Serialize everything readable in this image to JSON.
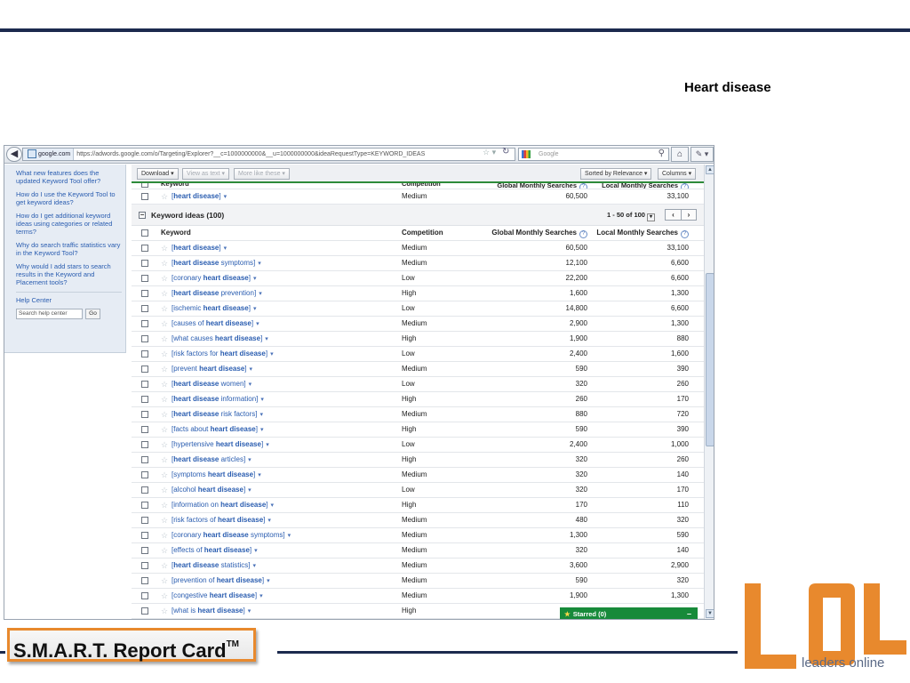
{
  "slide": {
    "title": "Heart disease"
  },
  "browser": {
    "site_label": "google.com",
    "url": "https://adwords.google.com/o/Targeting/Explorer?__c=1000000000&__u=1000000000&ideaRequestType=KEYWORD_IDEAS",
    "search_placeholder": "Google"
  },
  "help": {
    "links": [
      "What new features does the updated Keyword Tool offer?",
      "How do I use the Keyword Tool to get keyword ideas?",
      "How do I get additional keyword ideas using categories or related terms?",
      "Why do search traffic statistics vary in the Keyword Tool?",
      "Why would I add stars to search results in the Keyword and Placement tools?"
    ],
    "help_center": "Help Center",
    "search_placeholder": "Search help center",
    "go_label": "Go"
  },
  "toolbar": {
    "download": "Download ▾",
    "view_as_text": "View as text ▾",
    "more_like_these": "More like these ▾",
    "sorted_by": "Sorted by Relevance ▾",
    "columns": "Columns ▾"
  },
  "columns": {
    "keyword": "Keyword",
    "competition": "Competition",
    "global": "Global Monthly Searches",
    "local": "Local Monthly Searches"
  },
  "search_terms": [
    {
      "pre": "[",
      "bold": "heart disease",
      "post": "]",
      "competition": "Medium",
      "global": "60,500",
      "local": "33,100"
    }
  ],
  "ideas_group": {
    "title": "Keyword ideas (100)",
    "range": "1 - 50",
    "of_label": "of",
    "total": "100"
  },
  "keyword_ideas": [
    {
      "pre": "[",
      "bold": "heart disease",
      "post": "]",
      "competition": "Medium",
      "global": "60,500",
      "local": "33,100"
    },
    {
      "pre": "[",
      "bold": "heart disease",
      "post": " symptoms]",
      "competition": "Medium",
      "global": "12,100",
      "local": "6,600"
    },
    {
      "pre": "[coronary ",
      "bold": "heart disease",
      "post": "]",
      "competition": "Low",
      "global": "22,200",
      "local": "6,600"
    },
    {
      "pre": "[",
      "bold": "heart disease",
      "post": " prevention]",
      "competition": "High",
      "global": "1,600",
      "local": "1,300"
    },
    {
      "pre": "[ischemic ",
      "bold": "heart disease",
      "post": "]",
      "competition": "Low",
      "global": "14,800",
      "local": "6,600"
    },
    {
      "pre": "[causes of ",
      "bold": "heart disease",
      "post": "]",
      "competition": "Medium",
      "global": "2,900",
      "local": "1,300"
    },
    {
      "pre": "[what causes ",
      "bold": "heart disease",
      "post": "]",
      "competition": "High",
      "global": "1,900",
      "local": "880"
    },
    {
      "pre": "[risk factors for ",
      "bold": "heart disease",
      "post": "]",
      "competition": "Low",
      "global": "2,400",
      "local": "1,600"
    },
    {
      "pre": "[prevent ",
      "bold": "heart disease",
      "post": "]",
      "competition": "Medium",
      "global": "590",
      "local": "390"
    },
    {
      "pre": "[",
      "bold": "heart disease",
      "post": " women]",
      "competition": "Low",
      "global": "320",
      "local": "260"
    },
    {
      "pre": "[",
      "bold": "heart disease",
      "post": " information]",
      "competition": "High",
      "global": "260",
      "local": "170"
    },
    {
      "pre": "[",
      "bold": "heart disease",
      "post": " risk factors]",
      "competition": "Medium",
      "global": "880",
      "local": "720"
    },
    {
      "pre": "[facts about ",
      "bold": "heart disease",
      "post": "]",
      "competition": "High",
      "global": "590",
      "local": "390"
    },
    {
      "pre": "[hypertensive ",
      "bold": "heart disease",
      "post": "]",
      "competition": "Low",
      "global": "2,400",
      "local": "1,000"
    },
    {
      "pre": "[",
      "bold": "heart disease",
      "post": " articles]",
      "competition": "High",
      "global": "320",
      "local": "260"
    },
    {
      "pre": "[symptoms ",
      "bold": "heart disease",
      "post": "]",
      "competition": "Medium",
      "global": "320",
      "local": "140"
    },
    {
      "pre": "[alcohol ",
      "bold": "heart disease",
      "post": "]",
      "competition": "Low",
      "global": "320",
      "local": "170"
    },
    {
      "pre": "[information on ",
      "bold": "heart disease",
      "post": "]",
      "competition": "High",
      "global": "170",
      "local": "110"
    },
    {
      "pre": "[risk factors of ",
      "bold": "heart disease",
      "post": "]",
      "competition": "Medium",
      "global": "480",
      "local": "320"
    },
    {
      "pre": "[coronary ",
      "bold": "heart disease",
      "post": " symptoms]",
      "competition": "Medium",
      "global": "1,300",
      "local": "590"
    },
    {
      "pre": "[effects of ",
      "bold": "heart disease",
      "post": "]",
      "competition": "Medium",
      "global": "320",
      "local": "140"
    },
    {
      "pre": "[",
      "bold": "heart disease",
      "post": " statistics]",
      "competition": "Medium",
      "global": "3,600",
      "local": "2,900"
    },
    {
      "pre": "[prevention of ",
      "bold": "heart disease",
      "post": "]",
      "competition": "Medium",
      "global": "590",
      "local": "320"
    },
    {
      "pre": "[congestive ",
      "bold": "heart disease",
      "post": "]",
      "competition": "Medium",
      "global": "1,900",
      "local": "1,300"
    },
    {
      "pre": "[what is ",
      "bold": "heart disease",
      "post": "]",
      "competition": "High",
      "global": "",
      "local": ""
    }
  ],
  "starred": {
    "label": "Starred (0)",
    "minimize": "–"
  },
  "footer": {
    "report_card": "S.M.A.R.T. Report Card",
    "tm": "TM",
    "logo_text": "leaders online"
  },
  "colors": {
    "navy": "#1c2a4e",
    "orange": "#e8892d",
    "green": "#178a3a",
    "link": "#2a5db0"
  },
  "icons": [
    "back-arrow-icon",
    "star-icon",
    "reload-icon",
    "search-icon",
    "home-icon",
    "question-icon",
    "chevron-left-icon",
    "chevron-right-icon"
  ]
}
